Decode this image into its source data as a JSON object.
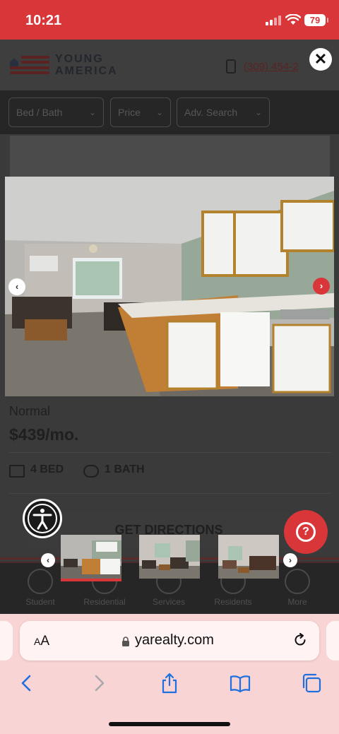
{
  "status_bar": {
    "time": "10:21",
    "battery": "79"
  },
  "site": {
    "logo_line1": "YOUNG",
    "logo_line2": "AMERICA",
    "phone": "(309) 454-2",
    "filters": [
      {
        "label": "Bed / Bath"
      },
      {
        "label": "Price"
      },
      {
        "label": "Adv. Search"
      }
    ],
    "listing": {
      "type": "Normal",
      "price": "$439/mo.",
      "beds": "4 BED",
      "baths": "1 BATH",
      "directions_label": "GET DIRECTIONS"
    },
    "nav": [
      {
        "label": "Student"
      },
      {
        "label": "Residential"
      },
      {
        "label": "Services"
      },
      {
        "label": "Residents"
      },
      {
        "label": "More"
      }
    ]
  },
  "lightbox": {
    "close": "✕",
    "prev": "‹",
    "next": "›",
    "thumbnails": [
      "Kitchen and living room",
      "Living room",
      "Living room with window"
    ],
    "active_thumbnail": 1
  },
  "help_button": {
    "symbol": "?"
  },
  "browser": {
    "text_size_label_small": "A",
    "text_size_label_large": "A",
    "url": "yarealty.com"
  },
  "colors": {
    "brand_red": "#d9363a",
    "safari_bg": "#f9d4d4"
  }
}
